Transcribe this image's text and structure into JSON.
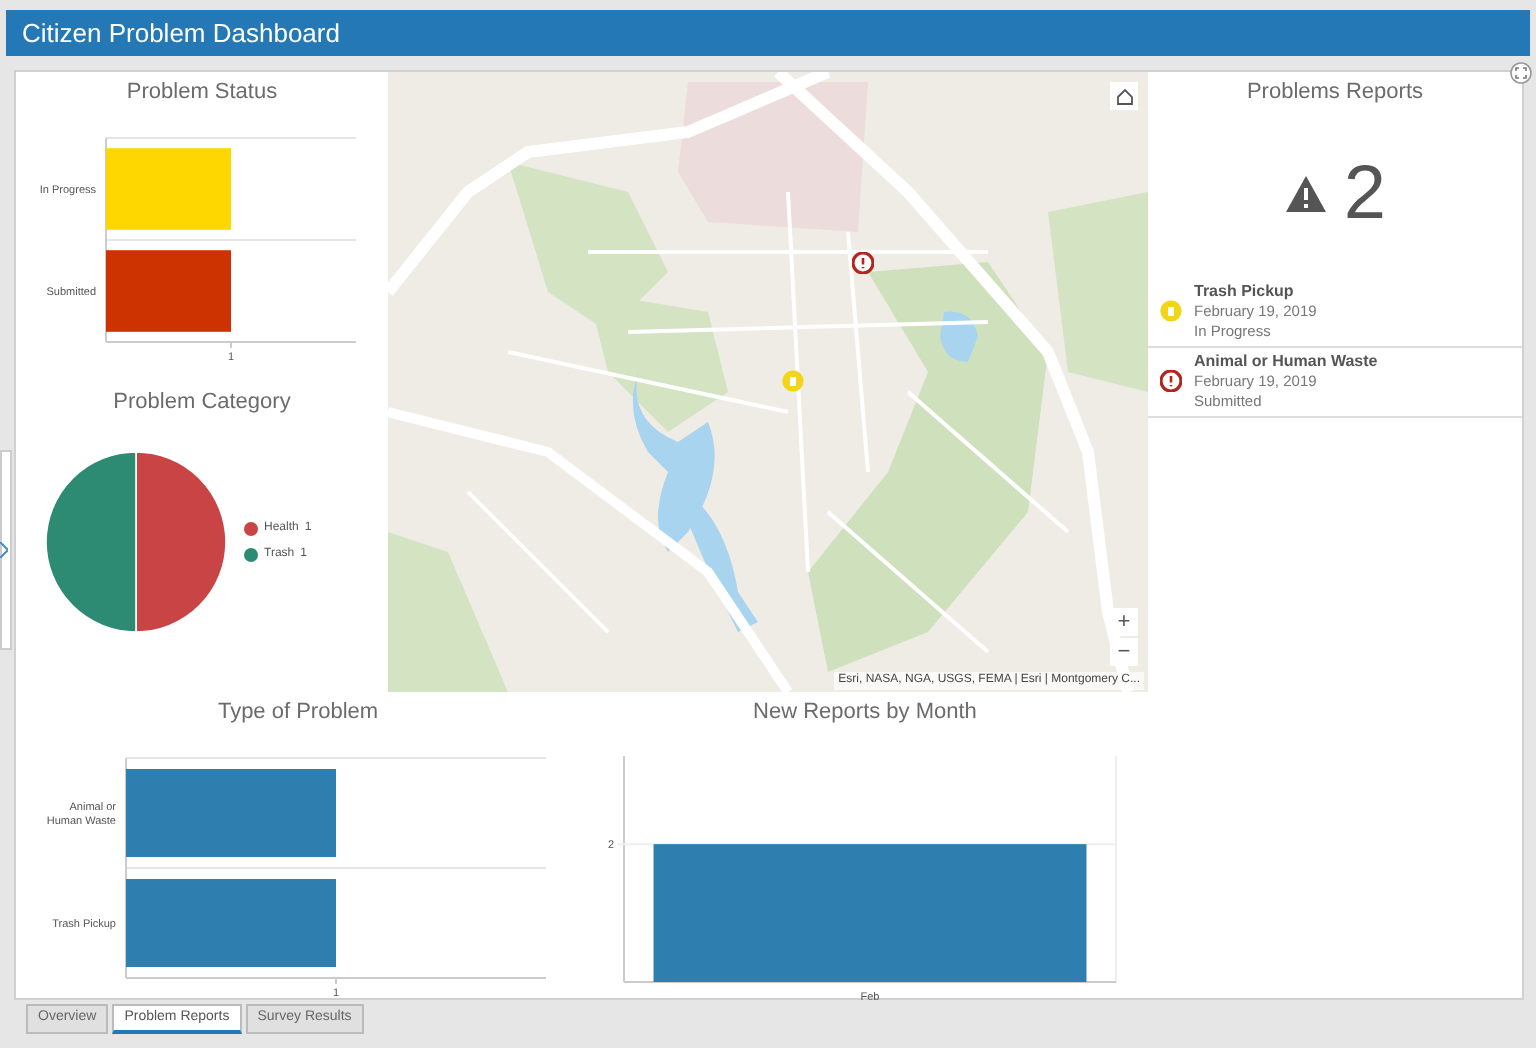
{
  "header": {
    "title": "Citizen Problem Dashboard"
  },
  "status_chart": {
    "title": "Problem Status",
    "tick_label": "1",
    "categories": [
      {
        "label": "In Progress",
        "color": "#ffd700"
      },
      {
        "label": "Submitted",
        "color": "#cc3300"
      }
    ]
  },
  "category_chart": {
    "title": "Problem Category",
    "legend": [
      {
        "label": "Health",
        "count": "1",
        "color": "#c94444"
      },
      {
        "label": "Trash",
        "count": "1",
        "color": "#2e8b73"
      }
    ]
  },
  "map": {
    "attribution": "Esri, NASA, NGA, USGS, FEMA | Esri | Montgomery C...",
    "zoom_in": "+",
    "zoom_out": "−"
  },
  "reports": {
    "title": "Problems Reports",
    "count": "2",
    "items": [
      {
        "kind": "trash",
        "title": "Trash Pickup",
        "date": "February 19, 2019",
        "status": "In Progress"
      },
      {
        "kind": "waste",
        "title": "Animal or Human Waste",
        "date": "February 19, 2019",
        "status": "Submitted"
      }
    ]
  },
  "type_chart": {
    "title": "Type of Problem",
    "tick_label": "1",
    "categories": [
      {
        "label": "Animal or Human Waste",
        "color": "#2e7fb0"
      },
      {
        "label": "Trash Pickup",
        "color": "#2e7fb0"
      }
    ]
  },
  "month_chart": {
    "title": "New Reports by Month",
    "tick_label": "2",
    "categories": [
      {
        "label": "Feb",
        "color": "#2e7fb0"
      }
    ]
  },
  "tabs": [
    {
      "label": "Overview",
      "selected": false
    },
    {
      "label": "Problem Reports",
      "selected": true
    },
    {
      "label": "Survey Results",
      "selected": false
    }
  ]
}
